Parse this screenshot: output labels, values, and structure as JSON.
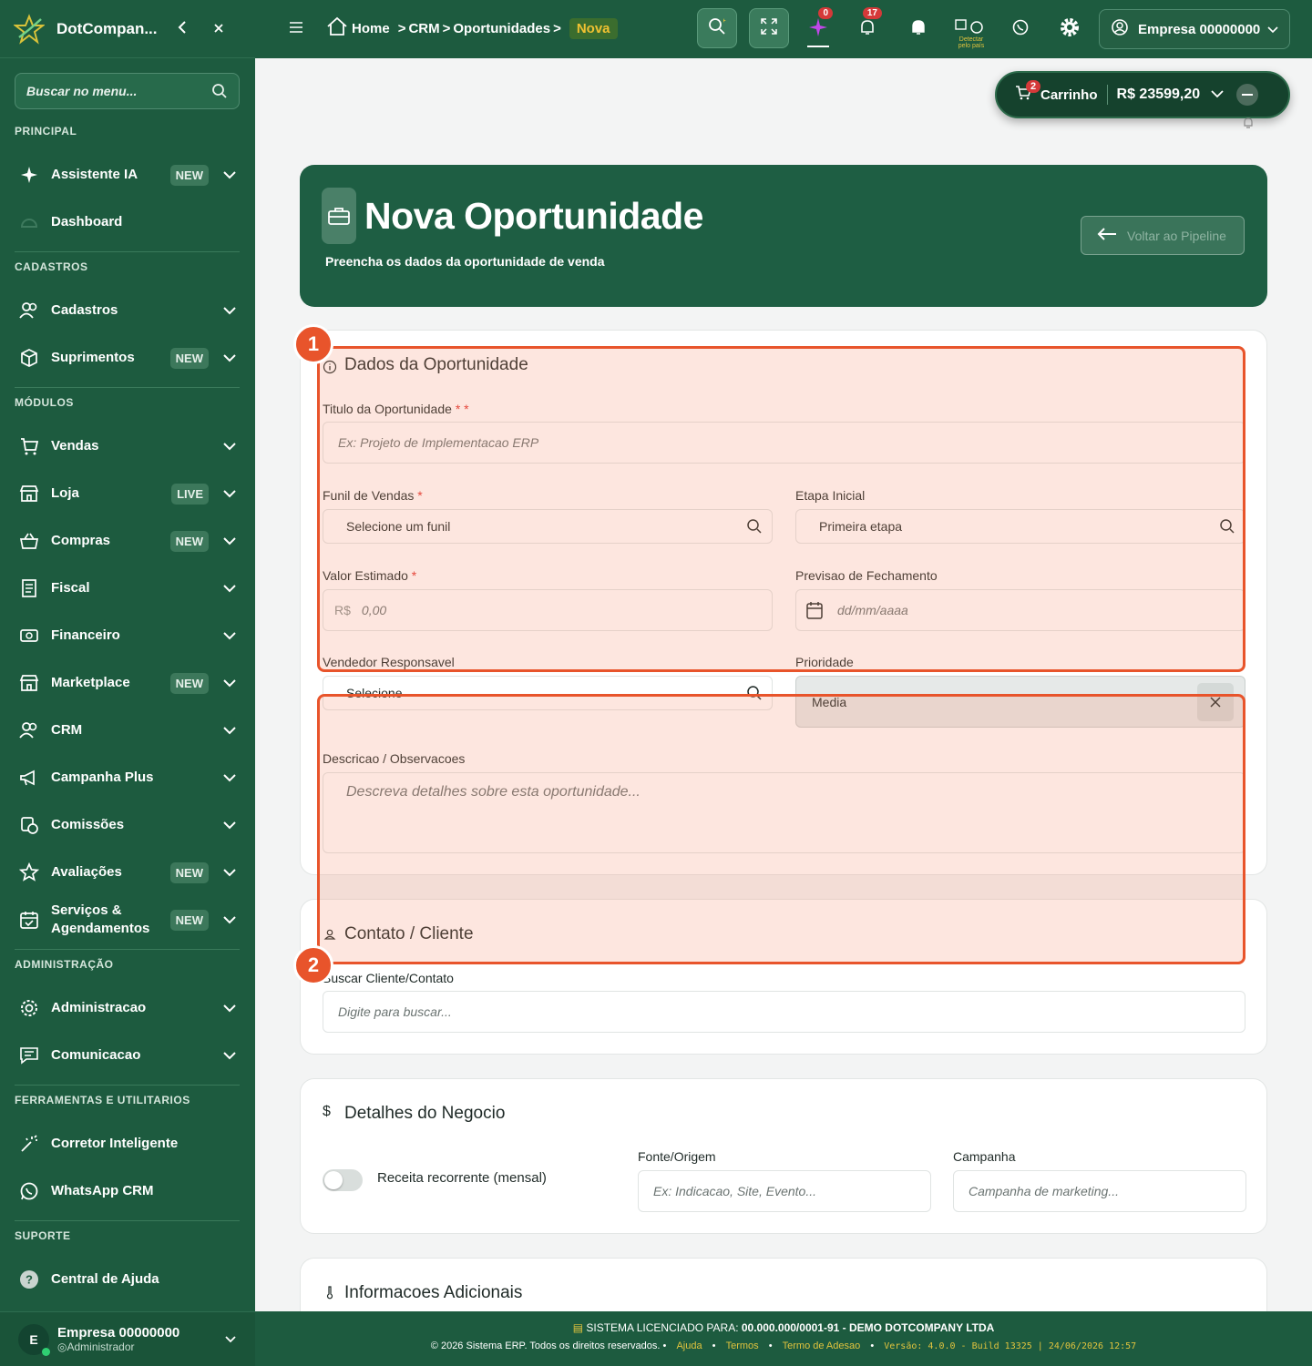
{
  "sidebar": {
    "brand": "DotCompan...",
    "search_placeholder": "Buscar no menu...",
    "sections": [
      {
        "title": "PRINCIPAL",
        "items": [
          {
            "label": "Assistente IA",
            "badge": "NEW",
            "icon": "sparkle-icon",
            "chevron": true
          },
          {
            "label": "Dashboard",
            "badge": "",
            "icon": "gauge-icon",
            "chevron": false
          }
        ]
      },
      {
        "title": "CADASTROS",
        "items": [
          {
            "label": "Cadastros",
            "badge": "",
            "icon": "users-icon",
            "chevron": true
          },
          {
            "label": "Suprimentos",
            "badge": "NEW",
            "icon": "box-icon",
            "chevron": true
          }
        ]
      },
      {
        "title": "MÓDULOS",
        "items": [
          {
            "label": "Vendas",
            "badge": "",
            "icon": "cart-icon",
            "chevron": true
          },
          {
            "label": "Loja",
            "badge": "LIVE",
            "icon": "store-icon",
            "chevron": true
          },
          {
            "label": "Compras",
            "badge": "NEW",
            "icon": "basket-icon",
            "chevron": true
          },
          {
            "label": "Fiscal",
            "badge": "",
            "icon": "receipt-icon",
            "chevron": true
          },
          {
            "label": "Financeiro",
            "badge": "",
            "icon": "money-icon",
            "chevron": true
          },
          {
            "label": "Marketplace",
            "badge": "NEW",
            "icon": "store-icon",
            "chevron": true
          },
          {
            "label": "CRM",
            "badge": "",
            "icon": "users-icon",
            "chevron": true
          },
          {
            "label": "Campanha Plus",
            "badge": "",
            "icon": "megaphone-icon",
            "chevron": true
          },
          {
            "label": "Comissões",
            "badge": "",
            "icon": "commission-icon",
            "chevron": true
          },
          {
            "label": "Avaliações",
            "badge": "NEW",
            "icon": "star-icon",
            "chevron": true
          },
          {
            "label": "Serviços & Agendamentos",
            "badge": "NEW",
            "icon": "calendar-check-icon",
            "chevron": true
          }
        ]
      },
      {
        "title": "ADMINISTRAÇÃO",
        "items": [
          {
            "label": "Administracao",
            "badge": "",
            "icon": "gear-icon",
            "chevron": true
          },
          {
            "label": "Comunicacao",
            "badge": "",
            "icon": "message-icon",
            "chevron": true
          }
        ]
      },
      {
        "title": "FERRAMENTAS E UTILITARIOS",
        "items": [
          {
            "label": "Corretor Inteligente",
            "badge": "",
            "icon": "magic-wand-icon",
            "chevron": false
          },
          {
            "label": "WhatsApp CRM",
            "badge": "",
            "icon": "whatsapp-icon",
            "chevron": false
          }
        ]
      },
      {
        "title": "SUPORTE",
        "items": [
          {
            "label": "Central de Ajuda",
            "badge": "",
            "icon": "help-icon",
            "chevron": false
          }
        ]
      }
    ],
    "user": {
      "initial": "E",
      "name": "Empresa 00000000",
      "role": "Administrador"
    }
  },
  "topbar": {
    "breadcrumb": [
      "Home",
      "CRM",
      "Oportunidades"
    ],
    "breadcrumb_current": "Nova",
    "ai_badge": "0",
    "notif_badge": "17",
    "detect_label": "Detectar pelo país",
    "user_label": "Empresa 00000000"
  },
  "cart": {
    "badge": "2",
    "label": "Carrinho",
    "amount": "R$ 23599,20"
  },
  "hero": {
    "title": "Nova Oportunidade",
    "subtitle": "Preencha os dados da oportunidade de venda",
    "back_label": "Voltar ao Pipeline"
  },
  "form": {
    "dados": {
      "title": "Dados da Oportunidade",
      "titulo_label": "Titulo da Oportunidade",
      "titulo_req": "* *",
      "titulo_placeholder": "Ex: Projeto de Implementacao ERP",
      "funil_label": "Funil de Vendas",
      "funil_value": "Selecione um funil",
      "etapa_label": "Etapa Inicial",
      "etapa_value": "Primeira etapa",
      "valor_label": "Valor Estimado",
      "valor_prefix": "R$",
      "valor_placeholder": "0,00",
      "previsao_label": "Previsao de Fechamento",
      "previsao_placeholder": "dd/mm/aaaa",
      "vendedor_label": "Vendedor Responsavel",
      "vendedor_value": "Selecione",
      "prioridade_label": "Prioridade",
      "prioridade_value": "Media",
      "descricao_label": "Descricao / Observacoes",
      "descricao_placeholder": "Descreva detalhes sobre esta oportunidade..."
    },
    "contato": {
      "title": "Contato / Cliente",
      "buscar_label": "Buscar Cliente/Contato",
      "buscar_placeholder": "Digite para buscar..."
    },
    "negocio": {
      "title": "Detalhes do Negocio",
      "icon_glyph": "$",
      "recorrente_label": "Receita recorrente (mensal)",
      "recorrente_on": false,
      "fonte_label": "Fonte/Origem",
      "fonte_placeholder": "Ex: Indicacao, Site, Evento...",
      "campanha_label": "Campanha",
      "campanha_placeholder": "Campanha de marketing..."
    },
    "adicionais": {
      "title": "Informacoes Adicionais"
    }
  },
  "annotations": [
    "1",
    "2"
  ],
  "footer": {
    "license_prefix": "SISTEMA LICENCIADO PARA:",
    "license_value": "00.000.000/0001-91 - DEMO DOTCOMPANY LTDA",
    "copyright": "© 2026 Sistema ERP. Todos os direitos reservados.",
    "links": [
      "Ajuda",
      "Termos",
      "Termo de Adesao"
    ],
    "version": "Versão: 4.0.0 - Build 13325 | 24/06/2026 12:57"
  },
  "colors": {
    "brand_green": "#1d5b3f",
    "accent_yellow": "#f0c131",
    "annotation_orange": "#e8542b",
    "required_red": "#e0342f"
  }
}
